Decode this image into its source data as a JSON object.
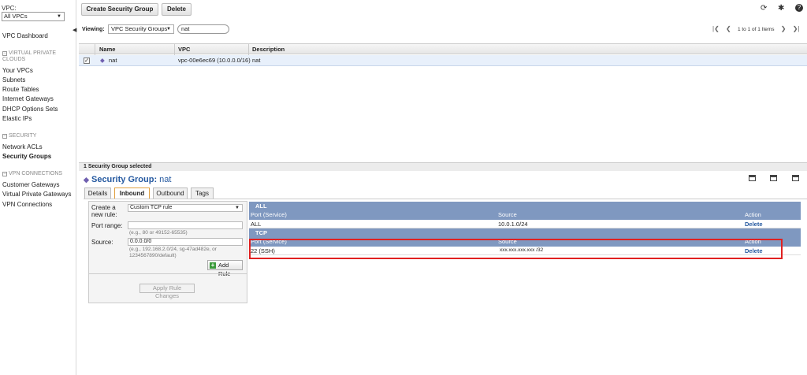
{
  "sidebar": {
    "vpc_label": "VPC:",
    "vpc_select": "All VPCs",
    "dashboard": "VPC Dashboard",
    "sections": [
      {
        "title_lines": [
          "VIRTUAL PRIVATE",
          "CLOUDS"
        ],
        "items": [
          "Your VPCs",
          "Subnets",
          "Route Tables",
          "Internet Gateways",
          "DHCP Options Sets",
          "Elastic IPs"
        ]
      },
      {
        "title_lines": [
          "SECURITY"
        ],
        "items": [
          "Network ACLs",
          "Security Groups"
        ]
      },
      {
        "title_lines": [
          "VPN CONNECTIONS"
        ],
        "items": [
          "Customer Gateways",
          "Virtual Private Gateways",
          "VPN Connections"
        ]
      }
    ],
    "active_item": "Security Groups"
  },
  "toolbar": {
    "create_label": "Create Security Group",
    "delete_label": "Delete",
    "icons": [
      "refresh-icon",
      "gear-icon",
      "help-icon"
    ]
  },
  "filter": {
    "viewing_label": "Viewing:",
    "select_value": "VPC Security Groups",
    "search_value": "nat",
    "pager_text": "1 to 1 of 1 Items"
  },
  "grid": {
    "columns": [
      "Name",
      "VPC",
      "Description"
    ],
    "rows": [
      {
        "name": "nat",
        "vpc": "vpc-00e6ec69 (10.0.0.0/16)",
        "description": "nat"
      }
    ]
  },
  "detail": {
    "selected_text": "1 Security Group selected",
    "title_prefix": "Security Group:",
    "title_name": "nat",
    "tabs": [
      "Details",
      "Inbound",
      "Outbound",
      "Tags"
    ],
    "active_tab": "Inbound"
  },
  "form": {
    "create_label_1": "Create a",
    "create_label_2": "new rule:",
    "rule_value": "Custom TCP rule",
    "port_label": "Port range:",
    "port_value": "",
    "port_hint": "(e.g., 80 or 49152-65535)",
    "source_label": "Source:",
    "source_value": "0.0.0.0/0",
    "source_hint_1": "(e.g., 192.168.2.0/24, sg-47ad482e, or",
    "source_hint_2": "1234567890/default)",
    "add_rule_label": "Add Rule",
    "apply_label": "Apply Rule Changes"
  },
  "rules": {
    "groups": [
      {
        "group": "ALL",
        "header": {
          "port": "Port (Service)",
          "source": "Source",
          "action": "Action"
        },
        "rows": [
          {
            "port": "ALL",
            "source": "10.0.1.0/24",
            "action": "Delete"
          }
        ]
      },
      {
        "group": "TCP",
        "header": {
          "port": "Port (Service)",
          "source": "Source",
          "action": "Action"
        },
        "rows": [
          {
            "port": "22 (SSH)",
            "source": "xxx.xxx.xxx.xxx /32",
            "action": "Delete"
          }
        ]
      }
    ]
  },
  "colors": {
    "accent": "#2559a0",
    "rule_header": "#7f98c0",
    "highlight": "#e02020"
  }
}
